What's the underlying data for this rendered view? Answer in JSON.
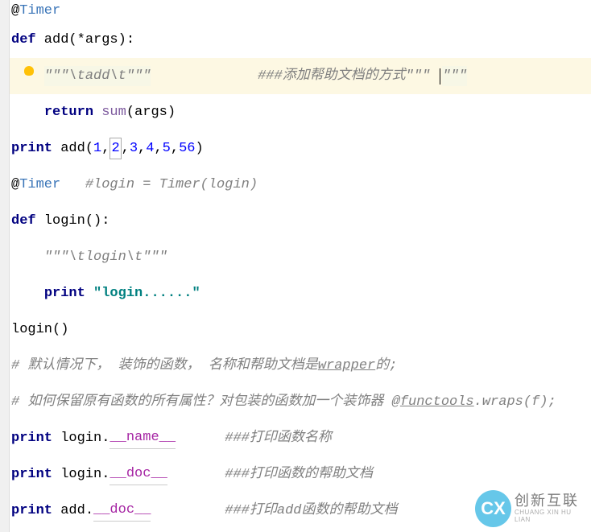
{
  "code": {
    "l1_at": "@",
    "l1_timer": "Timer",
    "l2_def": "def",
    "l2_name": " add",
    "l2_params": "(*args):",
    "l3_doc": "\"\"\"\\tadd\\t\"\"\"",
    "l3_comment": "###添加帮助文档的方式\"\"\" ",
    "l3_trail": "\"\"\"",
    "l4_return": "return",
    "l4_sum": " sum",
    "l4_args": "(args)",
    "l5_print": "print",
    "l5_add": " add(",
    "l5_n1": "1",
    "l5_n2": "2",
    "l5_n3": "3",
    "l5_n4": "4",
    "l5_n5": "5",
    "l5_n6": "56",
    "l5_close": ")",
    "comma": ",",
    "l6_at": "@",
    "l6_timer": "Timer",
    "l6_comment": "   #login = Timer(login)",
    "l7_def": "def",
    "l7_name": " login",
    "l7_params": "():",
    "l8_doc": "\"\"\"\\tlogin\\t\"\"\"",
    "l9_print": "print",
    "l9_str": " \"login......\"",
    "l10_login": "login",
    "l10_call": "()",
    "l11_comment": "# 默认情况下， 装饰的函数， 名称和帮助文档是",
    "l11_wrapper": "wrapper",
    "l11_end": "的;",
    "l12_comment": "# 如何保留原有函数的所有属性？对包装的函数加一个装饰器 @",
    "l12_functools": "functools",
    "l12_wraps": ".wraps(f)",
    "l12_semi": ";",
    "l13_print": "print",
    "l13_obj": " login.",
    "l13_dunder": "__name__",
    "l13_comment": "###打印函数名称",
    "l14_print": "print",
    "l14_obj": " login.",
    "l14_dunder": "__doc__",
    "l14_comment": "###打印函数的帮助文档",
    "l15_print": "print",
    "l15_obj": " add.",
    "l15_dunder": "__doc__",
    "l15_comment": "###打印add函数的帮助文档"
  },
  "watermark": {
    "icon": "CX",
    "cn": "创新互联",
    "en": "CHUANG XIN HU LIAN"
  }
}
